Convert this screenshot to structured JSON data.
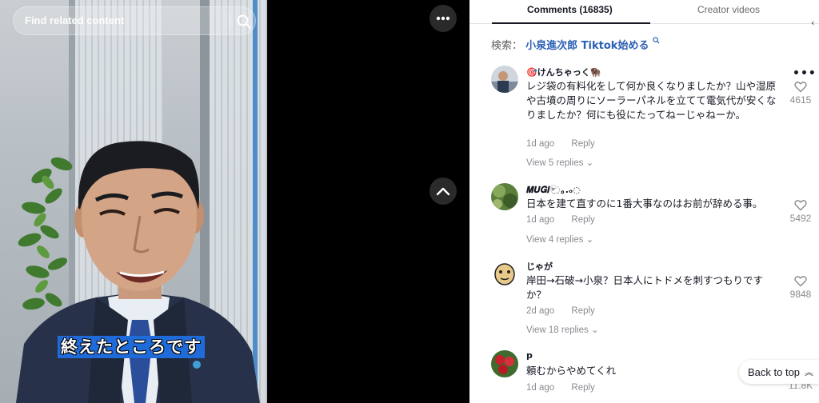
{
  "video": {
    "search_placeholder": "Find related content",
    "caption": "終えたところです"
  },
  "tabs": {
    "comments_label": "Comments (16835)",
    "creator_label": "Creator videos"
  },
  "related_search": {
    "prefix": "検索：",
    "query": "小泉進次郎 Tiktok始める"
  },
  "comments": [
    {
      "username": "🎯けんちゃっく🦬",
      "text": "レジ袋の有料化をして何か良くなりましたか？山や湿原や古墳の周りにソーラーパネルを立てて電気代が安くなりましたか？何にも役にたってねーじゃねーか。",
      "date": "1d ago",
      "reply_label": "Reply",
      "view_replies": "View 5 replies",
      "likes": "4615"
    },
    {
      "username": "𝑴𝑼𝑮𝑰🐑｡.ₒ◌",
      "text": "日本を建て直すのに1番大事なのはお前が辞める事。",
      "date": "1d ago",
      "reply_label": "Reply",
      "view_replies": "View 4 replies",
      "likes": "5492"
    },
    {
      "username": "じゃが",
      "text": "岸田→石破→小泉？日本人にトドメを刺すつもりですか？",
      "date": "2d ago",
      "reply_label": "Reply",
      "view_replies": "View 18 replies",
      "likes": "9848"
    },
    {
      "username": "p",
      "text": "頼むからやめてくれ",
      "date": "1d ago",
      "reply_label": "Reply",
      "likes": "11.8K"
    }
  ],
  "back_to_top": "Back to top",
  "colors": {
    "link": "#2b5fb4",
    "caption_bg": "#1f6bd9",
    "muted": "#8a8b91"
  }
}
